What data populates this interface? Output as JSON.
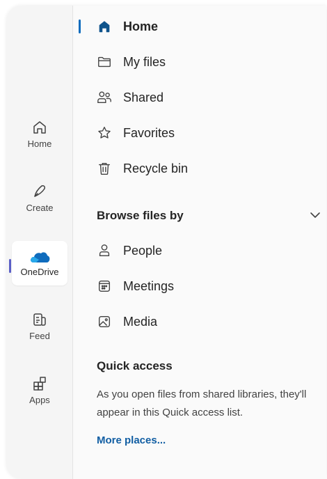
{
  "rail": {
    "items": [
      {
        "label": "Home",
        "icon": "home-icon"
      },
      {
        "label": "Create",
        "icon": "pen-icon"
      },
      {
        "label": "OneDrive",
        "icon": "onedrive-cloud-icon"
      },
      {
        "label": "Feed",
        "icon": "feed-icon"
      },
      {
        "label": "Apps",
        "icon": "apps-icon"
      }
    ],
    "active": "OneDrive"
  },
  "nav": {
    "items": [
      {
        "label": "Home",
        "icon": "home-filled-icon"
      },
      {
        "label": "My files",
        "icon": "folder-icon"
      },
      {
        "label": "Shared",
        "icon": "people-icon"
      },
      {
        "label": "Favorites",
        "icon": "star-icon"
      },
      {
        "label": "Recycle bin",
        "icon": "trash-icon"
      }
    ],
    "selected": "Home"
  },
  "browse": {
    "title": "Browse files by",
    "items": [
      {
        "label": "People",
        "icon": "person-icon"
      },
      {
        "label": "Meetings",
        "icon": "calendar-icon"
      },
      {
        "label": "Media",
        "icon": "image-icon"
      }
    ]
  },
  "quick_access": {
    "title": "Quick access",
    "description": "As you open files from shared libraries, they'll appear in this Quick access list.",
    "link": "More places..."
  },
  "colors": {
    "accent": "#0f6cbd",
    "rail_indicator": "#5b5fc7",
    "link": "#115ea3"
  }
}
